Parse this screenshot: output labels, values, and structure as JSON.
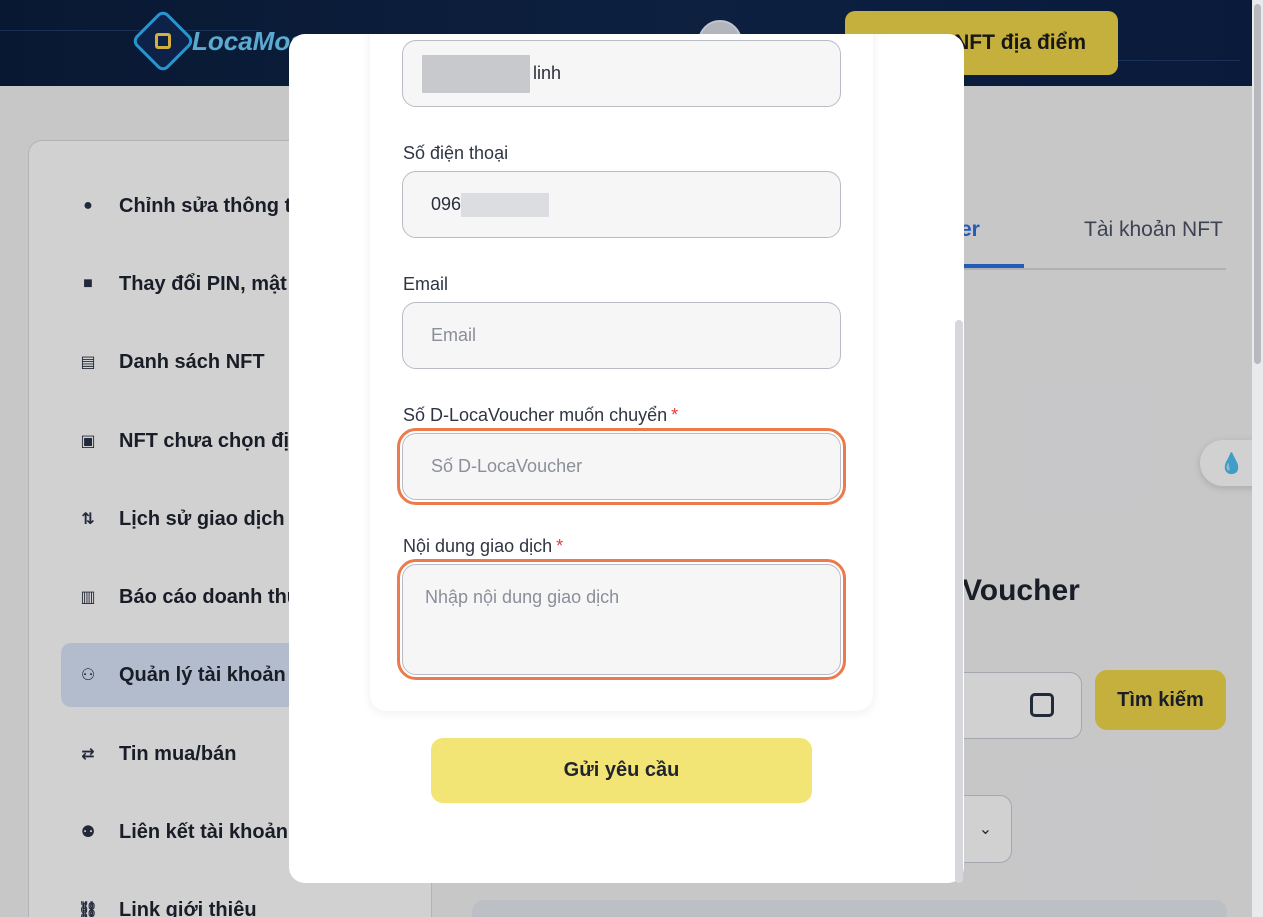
{
  "header": {
    "logo_text": "LocaMos",
    "nft_button_label": "NFT địa điểm"
  },
  "sidebar": {
    "items": [
      {
        "label": "Chỉnh sửa thông ti",
        "icon": "user-icon"
      },
      {
        "label": "Thay đổi PIN, mật",
        "icon": "lock-icon"
      },
      {
        "label": "Danh sách NFT",
        "icon": "document-icon"
      },
      {
        "label": "NFT chưa chọn địa",
        "icon": "gift-icon"
      },
      {
        "label": "Lịch sử giao dịch",
        "icon": "swap-vertical-icon"
      },
      {
        "label": "Báo cáo doanh thu",
        "icon": "report-icon"
      },
      {
        "label": "Quản lý tài khoản",
        "icon": "users-icon",
        "active": true
      },
      {
        "label": "Tin mua/bán",
        "icon": "swap-horizontal-icon"
      },
      {
        "label": "Liên kết tài khoản",
        "icon": "link-accounts-icon"
      },
      {
        "label": "Link giới thiệu",
        "icon": "chain-link-icon"
      }
    ]
  },
  "tabs": {
    "voucher_partial": "er",
    "nft_account": "Tài khoản NFT"
  },
  "background": {
    "heading_partial": "Voucher",
    "search_button": "Tìm kiếm"
  },
  "modal": {
    "name_field": {
      "value_suffix": "linh"
    },
    "phone": {
      "label": "Số điện thoại",
      "value_prefix": "096"
    },
    "email": {
      "label": "Email",
      "placeholder": "Email"
    },
    "voucher_amount": {
      "label": "Số D-LocaVoucher muốn chuyển",
      "required_mark": "*",
      "placeholder": "Số D-LocaVoucher"
    },
    "transaction_note": {
      "label": "Nội dung giao dịch",
      "required_mark": "*",
      "placeholder": "Nhập nội dung giao dịch"
    },
    "submit_label": "Gửi yêu cầu"
  }
}
